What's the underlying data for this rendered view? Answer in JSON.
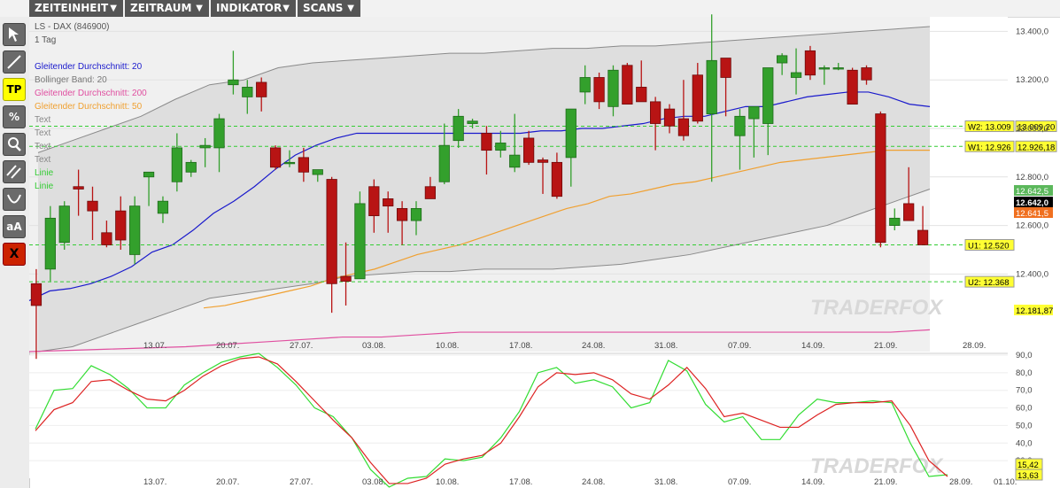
{
  "menu": [
    {
      "label": "ZEITEINHEIT"
    },
    {
      "label": "ZEITRAUM"
    },
    {
      "label": "INDIKATOR"
    },
    {
      "label": "SCANS"
    }
  ],
  "toolbar": {
    "tools": [
      {
        "name": "cursor-tool",
        "label": ""
      },
      {
        "name": "line-tool",
        "label": ""
      },
      {
        "name": "tp-tool",
        "label": "TP"
      },
      {
        "name": "percent-tool",
        "label": "%"
      },
      {
        "name": "zoom-tool",
        "label": ""
      },
      {
        "name": "parallel-lines-tool",
        "label": ""
      },
      {
        "name": "arc-tool",
        "label": ""
      },
      {
        "name": "text-tool",
        "label": "aA"
      },
      {
        "name": "delete-tool",
        "label": "X"
      }
    ]
  },
  "colors": {
    "bull": "#33a02c",
    "bear": "#b81414",
    "ma20": "#1a1acc",
    "ma200": "#e04fa0",
    "ma50": "#f0a030",
    "band_fill": "#dedede",
    "band_line": "#8a8a8a",
    "plot_bg": "#f0f0f0",
    "stoch_k": "#33dd33",
    "stoch_d": "#dd2222",
    "hline": "#33cc33",
    "tp_bg": "#ffff00",
    "del_bg": "#cc2200"
  },
  "legend": {
    "title": "LS - DAX",
    "code": "(846900)",
    "timeframe": "1 Tag",
    "items": [
      {
        "label": "Gleitender Durchschnitt: 20",
        "color": "#1a1acc"
      },
      {
        "label": "Bollinger Band: 20",
        "color": "#777777"
      },
      {
        "label": "Gleitender Durchschnitt: 200",
        "color": "#e04fa0"
      },
      {
        "label": "Gleitender Durchschnitt: 50",
        "color": "#f0a030"
      },
      {
        "label": "Text",
        "color": "#888888"
      },
      {
        "label": "Text",
        "color": "#888888"
      },
      {
        "label": "Text",
        "color": "#888888"
      },
      {
        "label": "Text",
        "color": "#888888"
      },
      {
        "label": "Linie",
        "color": "#33cc33"
      },
      {
        "label": "Linie",
        "color": "#33cc33"
      }
    ]
  },
  "watermark": "TRADERFOX",
  "chart_data": [
    {
      "type": "candlestick",
      "title": "LS - DAX",
      "x_tick_labels": [
        "13.07.",
        "20.07.",
        "27.07.",
        "03.08.",
        "10.08.",
        "17.08.",
        "24.08.",
        "31.08.",
        "07.09.",
        "14.09.",
        "21.09.",
        "28.09."
      ],
      "y_tick_labels": [
        "12.400,0",
        "12.600,0",
        "12.800,0",
        "13.000,0",
        "13.200,0",
        "13.400,0"
      ],
      "ylim": [
        12080,
        13460
      ],
      "grid": true,
      "candles": [
        {
          "o": 12360,
          "h": 12420,
          "l": 12050,
          "c": 12270
        },
        {
          "o": 12420,
          "h": 12680,
          "l": 12370,
          "c": 12630
        },
        {
          "o": 12530,
          "h": 12700,
          "l": 12500,
          "c": 12680
        },
        {
          "o": 12760,
          "h": 12830,
          "l": 12640,
          "c": 12750
        },
        {
          "o": 12700,
          "h": 12760,
          "l": 12540,
          "c": 12660
        },
        {
          "o": 12570,
          "h": 12620,
          "l": 12510,
          "c": 12520
        },
        {
          "o": 12660,
          "h": 12720,
          "l": 12500,
          "c": 12540
        },
        {
          "o": 12480,
          "h": 12720,
          "l": 12440,
          "c": 12680
        },
        {
          "o": 12800,
          "h": 12820,
          "l": 12680,
          "c": 12820
        },
        {
          "o": 12650,
          "h": 12720,
          "l": 12610,
          "c": 12700
        },
        {
          "o": 12780,
          "h": 12980,
          "l": 12740,
          "c": 12920
        },
        {
          "o": 12820,
          "h": 12870,
          "l": 12800,
          "c": 12860
        },
        {
          "o": 12920,
          "h": 12960,
          "l": 12840,
          "c": 12930
        },
        {
          "o": 12920,
          "h": 13060,
          "l": 12820,
          "c": 13040
        },
        {
          "o": 13180,
          "h": 13320,
          "l": 13140,
          "c": 13200
        },
        {
          "o": 13130,
          "h": 13200,
          "l": 13060,
          "c": 13170
        },
        {
          "o": 13190,
          "h": 13210,
          "l": 13070,
          "c": 13130
        },
        {
          "o": 12920,
          "h": 12930,
          "l": 12830,
          "c": 12840
        },
        {
          "o": 12860,
          "h": 12910,
          "l": 12840,
          "c": 12860
        },
        {
          "o": 12880,
          "h": 12920,
          "l": 12780,
          "c": 12820
        },
        {
          "o": 12810,
          "h": 12830,
          "l": 12780,
          "c": 12830
        },
        {
          "o": 12790,
          "h": 12800,
          "l": 12240,
          "c": 12360
        },
        {
          "o": 12390,
          "h": 12530,
          "l": 12270,
          "c": 12370
        },
        {
          "o": 12380,
          "h": 12740,
          "l": 12380,
          "c": 12690
        },
        {
          "o": 12760,
          "h": 12790,
          "l": 12570,
          "c": 12640
        },
        {
          "o": 12710,
          "h": 12740,
          "l": 12570,
          "c": 12680
        },
        {
          "o": 12670,
          "h": 12700,
          "l": 12520,
          "c": 12620
        },
        {
          "o": 12620,
          "h": 12700,
          "l": 12560,
          "c": 12670
        },
        {
          "o": 12760,
          "h": 12800,
          "l": 12740,
          "c": 12710
        },
        {
          "o": 12780,
          "h": 13020,
          "l": 12770,
          "c": 12930
        },
        {
          "o": 12950,
          "h": 13080,
          "l": 12920,
          "c": 13050
        },
        {
          "o": 13020,
          "h": 13040,
          "l": 13000,
          "c": 13030
        },
        {
          "o": 12980,
          "h": 13010,
          "l": 12810,
          "c": 12910
        },
        {
          "o": 12910,
          "h": 12990,
          "l": 12880,
          "c": 12940
        },
        {
          "o": 12840,
          "h": 13060,
          "l": 12820,
          "c": 12890
        },
        {
          "o": 12960,
          "h": 12990,
          "l": 12850,
          "c": 12860
        },
        {
          "o": 12870,
          "h": 12880,
          "l": 12730,
          "c": 12860
        },
        {
          "o": 12860,
          "h": 12900,
          "l": 12710,
          "c": 12720
        },
        {
          "o": 12880,
          "h": 13080,
          "l": 12760,
          "c": 13080
        },
        {
          "o": 13150,
          "h": 13260,
          "l": 13100,
          "c": 13210
        },
        {
          "o": 13210,
          "h": 13230,
          "l": 13080,
          "c": 13110
        },
        {
          "o": 13090,
          "h": 13260,
          "l": 13050,
          "c": 13240
        },
        {
          "o": 13260,
          "h": 13270,
          "l": 13100,
          "c": 13100
        },
        {
          "o": 13170,
          "h": 13280,
          "l": 13120,
          "c": 13110
        },
        {
          "o": 13110,
          "h": 13130,
          "l": 12910,
          "c": 13020
        },
        {
          "o": 13080,
          "h": 13100,
          "l": 12980,
          "c": 13010
        },
        {
          "o": 13040,
          "h": 13200,
          "l": 12950,
          "c": 12970
        },
        {
          "o": 13220,
          "h": 13270,
          "l": 13020,
          "c": 13030
        },
        {
          "o": 13060,
          "h": 13470,
          "l": 12780,
          "c": 13280
        },
        {
          "o": 13290,
          "h": 13280,
          "l": 13050,
          "c": 13210
        },
        {
          "o": 12970,
          "h": 13080,
          "l": 12830,
          "c": 13050
        },
        {
          "o": 13040,
          "h": 13090,
          "l": 12880,
          "c": 13090
        },
        {
          "o": 13020,
          "h": 13120,
          "l": 12890,
          "c": 13250
        },
        {
          "o": 13270,
          "h": 13310,
          "l": 13220,
          "c": 13300
        },
        {
          "o": 13210,
          "h": 13330,
          "l": 13140,
          "c": 13230
        },
        {
          "o": 13320,
          "h": 13340,
          "l": 13200,
          "c": 13220
        },
        {
          "o": 13250,
          "h": 13260,
          "l": 13180,
          "c": 13250
        },
        {
          "o": 13250,
          "h": 13270,
          "l": 13240,
          "c": 13250
        },
        {
          "o": 13240,
          "h": 13250,
          "l": 13100,
          "c": 13100
        },
        {
          "o": 13250,
          "h": 13260,
          "l": 13180,
          "c": 13200
        },
        {
          "o": 13060,
          "h": 13070,
          "l": 12510,
          "c": 12530
        },
        {
          "o": 12600,
          "h": 12670,
          "l": 12580,
          "c": 12630
        },
        {
          "o": 12690,
          "h": 12840,
          "l": 12620,
          "c": 12620
        },
        {
          "o": 12580,
          "h": 12680,
          "l": 12520,
          "c": 12520
        }
      ],
      "ma20": [
        12290,
        12330,
        12340,
        12360,
        12390,
        12430,
        12490,
        12520,
        12580,
        12650,
        12700,
        12760,
        12830,
        12890,
        12930,
        12960,
        12980,
        12980,
        12980,
        12980,
        12980,
        12980,
        12980,
        12980,
        12980,
        12990,
        12990,
        13000,
        13000,
        13010,
        13020,
        13040,
        13050,
        13050,
        13070,
        13090,
        13090,
        13110,
        13130,
        13140,
        13150,
        13150,
        13130,
        13100,
        13090
      ],
      "ma50": [
        12260,
        12270,
        12290,
        12310,
        12330,
        12350,
        12380,
        12400,
        12420,
        12450,
        12480,
        12500,
        12520,
        12550,
        12580,
        12610,
        12640,
        12670,
        12690,
        12720,
        12730,
        12750,
        12770,
        12780,
        12800,
        12820,
        12840,
        12860,
        12870,
        12880,
        12890,
        12900,
        12910,
        12910,
        12910
      ],
      "ma200": [
        12080,
        12085,
        12090,
        12095,
        12100,
        12110,
        12120,
        12130,
        12140,
        12140,
        12150,
        12160,
        12160,
        12160,
        12160,
        12160,
        12160,
        12160,
        12160,
        12160,
        12160,
        12160,
        12160,
        12170
      ],
      "bb_upper": [
        12900,
        12950,
        13000,
        13050,
        13120,
        13180,
        13200,
        13250,
        13270,
        13280,
        13290,
        13300,
        13310,
        13310,
        13320,
        13330,
        13330,
        13340,
        13340,
        13350,
        13360,
        13370,
        13380,
        13390,
        13400,
        13410,
        13420
      ],
      "bb_lower": [
        12080,
        12100,
        12150,
        12200,
        12250,
        12300,
        12320,
        12340,
        12360,
        12390,
        12400,
        12410,
        12410,
        12420,
        12420,
        12420,
        12430,
        12440,
        12460,
        12480,
        12510,
        12540,
        12570,
        12600,
        12650,
        12700,
        12750
      ],
      "horizontal_lines": [
        {
          "label": "W2: 13.009",
          "value": 13009,
          "value_label": "13.009,20",
          "color": "#33cc33"
        },
        {
          "label": "W1: 12.926",
          "value": 12926,
          "value_label": "12.926,18",
          "color": "#33cc33"
        },
        {
          "label": "U1: 12.520",
          "value": 12520,
          "value_label": "",
          "color": "#33cc33"
        },
        {
          "label": "U2: 12.368",
          "value": 12368,
          "value_label": "",
          "color": "#33cc33"
        }
      ],
      "price_tags": [
        {
          "value": 12642.5,
          "label": "12.642,5",
          "bg": "#5cb85c",
          "fg": "#ffffff"
        },
        {
          "value": 12642.0,
          "label": "12.642,0",
          "bg": "#000000",
          "fg": "#ffffff"
        },
        {
          "value": 12641.5,
          "label": "12.641,5",
          "bg": "#f07020",
          "fg": "#ffffff"
        },
        {
          "value": 12181.87,
          "label": "12.181,87",
          "bg": "#ffff33",
          "fg": "#000000"
        }
      ]
    },
    {
      "type": "line",
      "title": "",
      "x_tick_labels": [
        "13.07.",
        "20.07.",
        "27.07.",
        "03.08.",
        "10.08.",
        "17.08.",
        "24.08.",
        "31.08.",
        "07.09.",
        "14.09.",
        "21.09.",
        "28.09.",
        "01.10."
      ],
      "y_tick_labels": [
        "30,0",
        "40,0",
        "50,0",
        "60,0",
        "70,0",
        "80,0",
        "90,0"
      ],
      "ylim": [
        20,
        90
      ],
      "series": [
        {
          "name": "",
          "color": "#33dd33",
          "values": [
            48,
            70,
            71,
            84,
            79,
            71,
            60,
            60,
            73,
            80,
            86,
            89,
            91,
            83,
            73,
            60,
            55,
            43,
            25,
            15,
            20,
            21,
            31,
            30,
            32,
            43,
            58,
            80,
            83,
            74,
            76,
            72,
            60,
            63,
            87,
            81,
            62,
            52,
            55,
            42,
            42,
            56,
            65,
            63,
            63,
            64,
            63,
            40,
            21,
            22
          ]
        },
        {
          "name": "",
          "color": "#dd2222",
          "values": [
            47,
            59,
            63,
            75,
            76,
            70,
            65,
            64,
            70,
            78,
            84,
            88,
            89,
            85,
            75,
            64,
            53,
            43,
            29,
            17,
            17,
            20,
            28,
            31,
            33,
            40,
            55,
            72,
            80,
            79,
            80,
            76,
            68,
            65,
            73,
            83,
            71,
            55,
            57,
            53,
            49,
            49,
            56,
            62,
            63,
            63,
            64,
            50,
            30,
            21
          ]
        }
      ],
      "value_tags": [
        {
          "value": 15.42,
          "label": "15,42",
          "bg": "#ffff33",
          "fg": "#000000"
        },
        {
          "value": 13.63,
          "label": "13,63",
          "bg": "#ffff33",
          "fg": "#000000"
        }
      ]
    }
  ]
}
